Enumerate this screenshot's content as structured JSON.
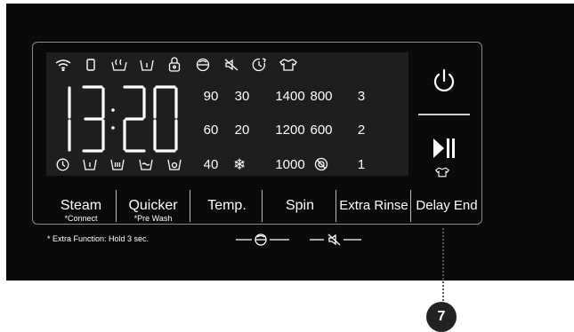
{
  "display": {
    "time": "13:20",
    "top_icons": [
      "wifi-icon",
      "phone-icon",
      "steam-icon",
      "drum-clean-icon",
      "child-lock-icon",
      "extra-rinse-icon",
      "mute-icon",
      "delay-end-icon",
      "quick-icon"
    ],
    "bottom_icons": [
      "timer-icon",
      "prewash-icon",
      "wash-icon",
      "rinse-icon",
      "spin-dry-icon"
    ],
    "temps": [
      "90",
      "30",
      "60",
      "20",
      "40"
    ],
    "cold_icon": "snowflake-icon",
    "spins": [
      "1400",
      "800",
      "1200",
      "600",
      "1000"
    ],
    "no_spin_icon": "no-spin-icon",
    "levels": [
      "3",
      "2",
      "1"
    ]
  },
  "buttons": [
    {
      "label": "Steam",
      "sub": "*Connect"
    },
    {
      "label": "Quicker",
      "sub": "*Pre Wash"
    },
    {
      "label": "Temp.",
      "sub": ""
    },
    {
      "label": "Spin",
      "sub": ""
    },
    {
      "label": "Extra Rinse",
      "sub": ""
    },
    {
      "label": "Delay End",
      "sub": ""
    }
  ],
  "power_icon": "power-icon",
  "start_pause_icon": "play-pause-icon",
  "footnote": "* Extra Function: Hold 3 sec.",
  "callout": "7"
}
